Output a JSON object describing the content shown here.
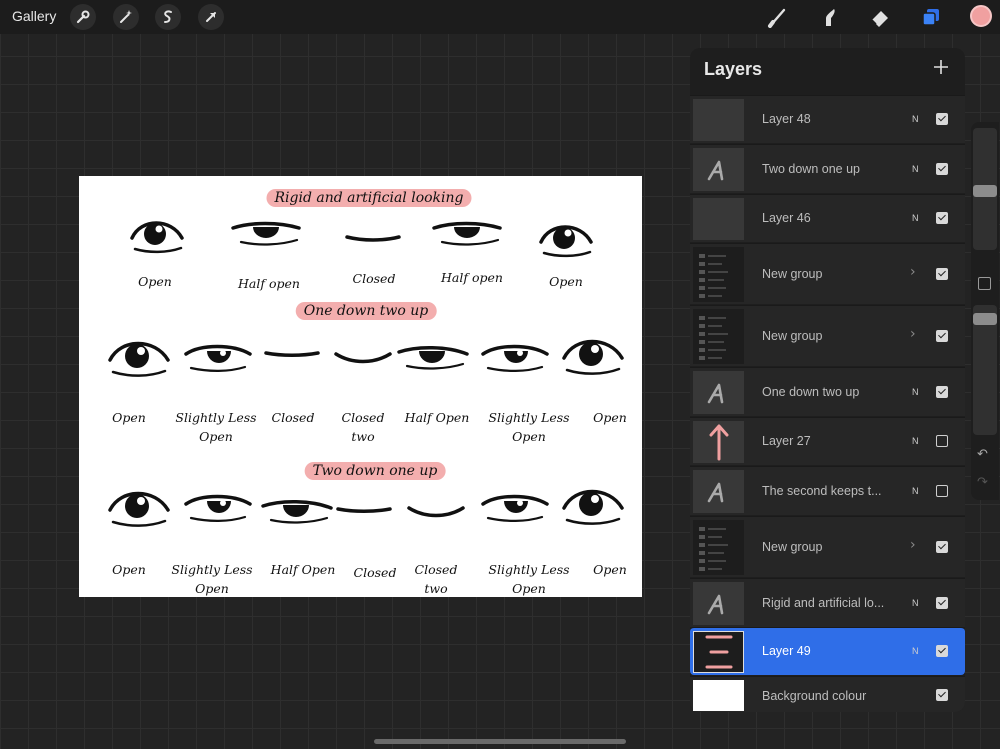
{
  "toolbar": {
    "gallery_label": "Gallery",
    "left_tools": [
      "wrench-icon",
      "magic-wand-icon",
      "selection-icon",
      "transform-arrow-icon"
    ],
    "right_tools": [
      "brush-icon",
      "smudge-icon",
      "eraser-icon",
      "layers-icon"
    ],
    "current_color": "#f0a0a0"
  },
  "canvas": {
    "headings": [
      "Rigid and artificial looking",
      "One down two up",
      "Two down one up"
    ],
    "row1_labels": [
      "Open",
      "Half open",
      "Closed",
      "Half open",
      "Open"
    ],
    "row2_labels": [
      "Open",
      "Slightly Less\nOpen",
      "Closed",
      "Closed\ntwo",
      "Half Open",
      "Slightly Less\nOpen",
      "Open"
    ],
    "row3_labels": [
      "Open",
      "Slightly Less\nOpen",
      "Half Open",
      "Closed",
      "Closed\ntwo",
      "Slightly Less\nOpen",
      "Open"
    ],
    "highlight_color": "#f3aeae"
  },
  "layers_panel": {
    "title": "Layers",
    "add_icon": "plus-icon",
    "layers": [
      {
        "name": "Layer 48",
        "thumb": "blank",
        "mode": "N",
        "visible": true
      },
      {
        "name": "Two down one up",
        "thumb": "text",
        "mode": "N",
        "visible": true
      },
      {
        "name": "Layer 46",
        "thumb": "blank",
        "mode": "N",
        "visible": true
      },
      {
        "name": "New group",
        "thumb": "group",
        "visible": true
      },
      {
        "name": "New group",
        "thumb": "group",
        "visible": true
      },
      {
        "name": "One down two up",
        "thumb": "text",
        "mode": "N",
        "visible": true
      },
      {
        "name": "Layer 27",
        "thumb": "arrow",
        "mode": "N",
        "visible": false
      },
      {
        "name": "The second keeps t...",
        "thumb": "text",
        "mode": "N",
        "visible": false
      },
      {
        "name": "New group",
        "thumb": "group",
        "visible": true
      },
      {
        "name": "Rigid and artificial lo...",
        "thumb": "text",
        "mode": "N",
        "visible": true
      },
      {
        "name": "Layer 49",
        "thumb": "stripes",
        "mode": "N",
        "visible": true,
        "selected": true
      },
      {
        "name": "Background colour",
        "thumb": "white",
        "visible": true
      }
    ]
  },
  "side_controls": {
    "brush_size_level": 0.55,
    "opacity_level": 0.7,
    "undo_icon": "undo-icon",
    "redo_icon": "redo-icon"
  }
}
